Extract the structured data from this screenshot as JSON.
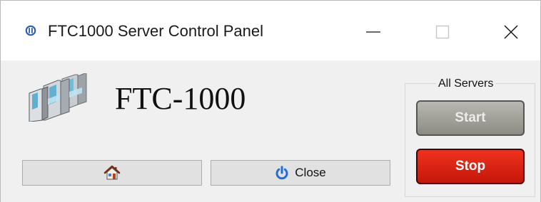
{
  "window": {
    "title": "FTC1000 Server Control Panel",
    "icons": {
      "app": "app-logo-icon",
      "minimize": "minimize-icon",
      "maximize": "maximize-icon",
      "close": "close-icon"
    }
  },
  "header": {
    "product_name": "FTC-1000",
    "image": "turnstile-gates-image"
  },
  "footer": {
    "home_icon": "home-icon",
    "close_icon": "power-icon",
    "close_label": "Close"
  },
  "servers": {
    "group_label": "All Servers",
    "start_label": "Start",
    "stop_label": "Stop"
  },
  "colors": {
    "stop": "#d9200f",
    "start": "#a3a39b",
    "power_icon": "#1e6fd9"
  }
}
